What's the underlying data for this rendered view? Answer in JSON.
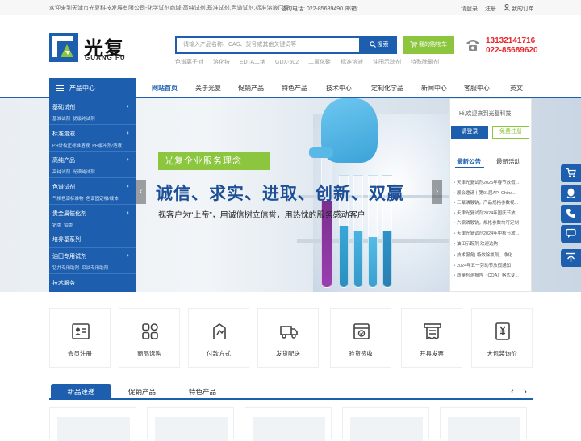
{
  "topbar": {
    "welcome": "欢迎来到天津市光复科技发展有限公司-化学试剂商城-高纯试剂,基准试剂,色谱试剂,标准溶液厂家!",
    "hotline": "咨询电话: 022-85689490",
    "email": "邮箱:",
    "login": "请登录",
    "register": "注册",
    "orders": "我的订单"
  },
  "logo": {
    "cn": "光复",
    "en": "GUANG FU"
  },
  "search": {
    "placeholder": "请输入产品名称、CAS、货号或其他关键词等",
    "button": "搜索",
    "hot_keywords": [
      "色谱离子对",
      "溶化铵",
      "EDTA二钠",
      "GDX-502",
      "二氯化硅",
      "标准溶液",
      "油田示踪剂",
      "特殊除氯剂"
    ]
  },
  "cart": {
    "label": "我的购物车"
  },
  "contact": {
    "phone1": "13132141716",
    "phone2": "022-85689620"
  },
  "nav": {
    "category_label": "产品中心",
    "items": [
      "网站首页",
      "关于光复",
      "促销产品",
      "特色产品",
      "技术中心",
      "定制化学品",
      "新闻中心",
      "客服中心",
      "英文"
    ]
  },
  "sidebar": {
    "categories": [
      {
        "name": "基础试剂",
        "subs": [
          "基准试剂",
          "优级纯试剂"
        ]
      },
      {
        "name": "标准溶液",
        "subs": [
          "PH计校正标准溶液",
          "PH缓冲剂/溶液"
        ]
      },
      {
        "name": "高纯产品",
        "subs": [
          "高纯试剂",
          "光谱纯试剂"
        ]
      },
      {
        "name": "色谱试剂",
        "subs": [
          "气相色谱标准物",
          "色谱固定相/载体"
        ]
      },
      {
        "name": "贵金属催化剂",
        "subs": [
          "钯类",
          "铂类"
        ]
      },
      {
        "name": "培养基系列",
        "subs": []
      },
      {
        "name": "油田专用试剂",
        "subs": [
          "钻井专用助剂",
          "采油专用助剂"
        ]
      },
      {
        "name": "技术服务",
        "subs": []
      }
    ]
  },
  "banner": {
    "tag": "光复企业服务理念",
    "headline": "诚信、求实、进取、创新、双赢",
    "subline": "视客户为“上帝”，用诚信树立信誉，用热忱的服务感动客户"
  },
  "panel": {
    "welcome": "Hi,欢迎来到光复科技!",
    "login": "请登录",
    "register": "免费注册",
    "tab_announce": "最新公告",
    "tab_activity": "最新活动",
    "news": [
      "天津光复试剂2025年春节放假...",
      "展会邀请丨第91届API China...",
      "三聚磷酸钠，产品规格参数视...",
      "天津光复试剂2024年国庆节放...",
      "六偏磷酸钠，规格参数均可定制",
      "天津光复试剂2024年中秋节放...",
      "油田示踪剂 欢迎选购",
      "技术服务| 特效除氯剂、净化...",
      "2024年五一劳动节放假通知",
      "质量检测报告（COA）格式变..."
    ]
  },
  "services": [
    {
      "label": "会员注册",
      "icon": "id-card-icon"
    },
    {
      "label": "商品选购",
      "icon": "grid-icon"
    },
    {
      "label": "付款方式",
      "icon": "payment-icon"
    },
    {
      "label": "发货配送",
      "icon": "truck-icon"
    },
    {
      "label": "验货签收",
      "icon": "check-box-icon"
    },
    {
      "label": "开具发票",
      "icon": "invoice-icon"
    },
    {
      "label": "大包装询价",
      "icon": "yen-icon"
    }
  ],
  "product_tabs": [
    "新品速递",
    "促销产品",
    "特色产品"
  ],
  "colors": {
    "primary": "#1d5fae",
    "green": "#8cc63f",
    "red": "#e8262a"
  }
}
